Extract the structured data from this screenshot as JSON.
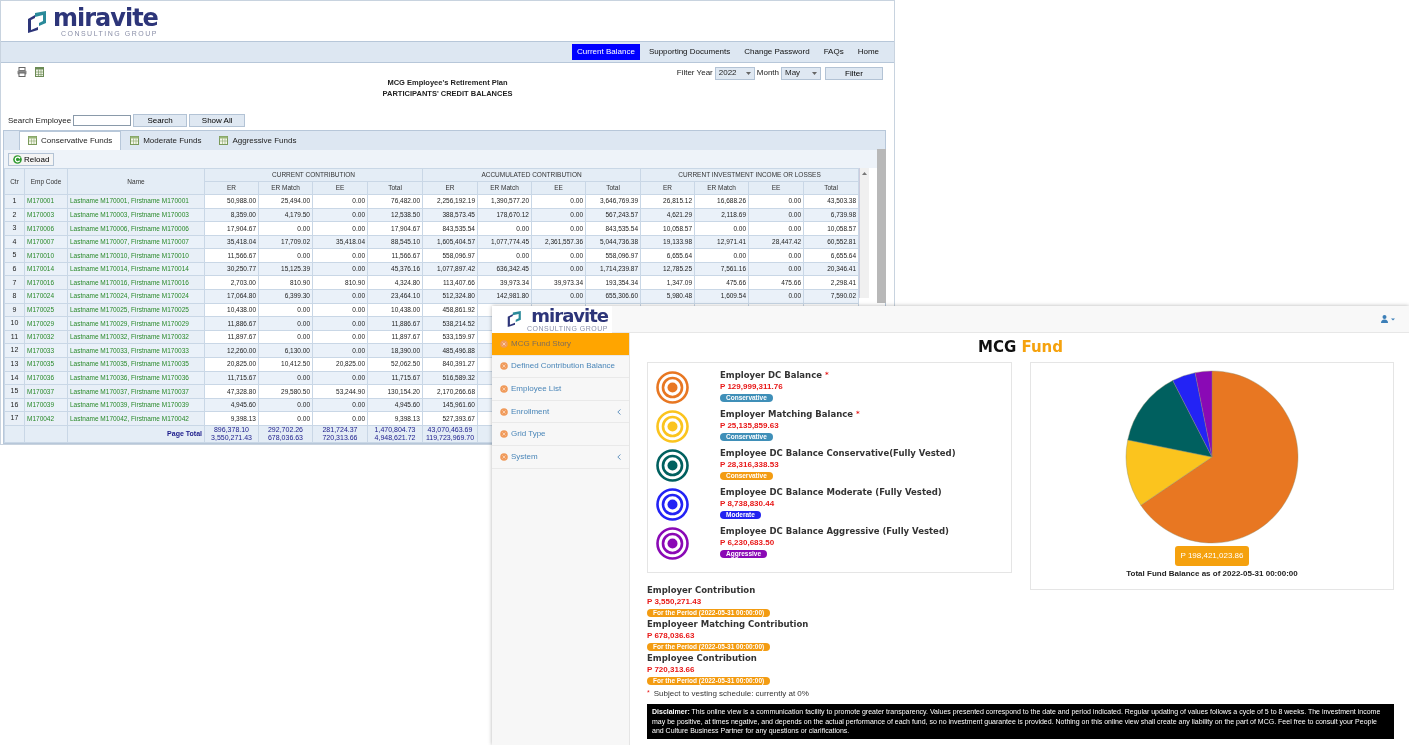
{
  "back_window": {
    "logo": {
      "name": "miravite",
      "tagline": "CONSULTING GROUP"
    },
    "nav": [
      {
        "label": "Current Balance",
        "selected": true
      },
      {
        "label": "Supporting Documents",
        "selected": false
      },
      {
        "label": "Change Password",
        "selected": false
      },
      {
        "label": "FAQs",
        "selected": false
      },
      {
        "label": "Home",
        "selected": false
      }
    ],
    "title": "MCG Employee's Retirement Plan",
    "subtitle": "PARTICIPANTS' CREDIT BALANCES",
    "filter": {
      "year_label": "Filter Year",
      "year": "2022",
      "month_label": "Month",
      "month": "May",
      "button": "Filter"
    },
    "search": {
      "label": "Search Employee",
      "button": "Search",
      "show_all": "Show All"
    },
    "tabs": [
      {
        "label": "Conservative Funds",
        "selected": true
      },
      {
        "label": "Moderate Funds",
        "selected": false
      },
      {
        "label": "Aggressive Funds",
        "selected": false
      }
    ],
    "reload": "Reload",
    "table": {
      "columns": [
        "Ctr",
        "Emp Code",
        "Name"
      ],
      "groups": [
        "CURRENT CONTRIBUTION",
        "ACCUMULATED CONTRIBUTION",
        "CURRENT INVESTMENT INCOME OR LOSSES"
      ],
      "sub_columns": [
        "ER",
        "ER Match",
        "EE",
        "Total",
        "ER",
        "ER Match",
        "EE",
        "Total",
        "ER",
        "ER Match",
        "EE",
        "Total"
      ],
      "rows": [
        {
          "ctr": "1",
          "code": "M170001",
          "name": "Lastname M170001, Firstname M170001",
          "values": [
            "50,988.00",
            "25,494.00",
            "0.00",
            "76,482.00",
            "2,256,192.19",
            "1,390,577.20",
            "0.00",
            "3,646,769.39",
            "26,815.12",
            "16,688.26",
            "0.00",
            "43,503.38"
          ]
        },
        {
          "ctr": "2",
          "code": "M170003",
          "name": "Lastname M170003, Firstname M170003",
          "values": [
            "8,359.00",
            "4,179.50",
            "0.00",
            "12,538.50",
            "388,573.45",
            "178,670.12",
            "0.00",
            "567,243.57",
            "4,621.29",
            "2,118.69",
            "0.00",
            "6,739.98"
          ]
        },
        {
          "ctr": "3",
          "code": "M170006",
          "name": "Lastname M170006, Firstname M170006",
          "values": [
            "17,904.67",
            "0.00",
            "0.00",
            "17,904.67",
            "843,535.54",
            "0.00",
            "0.00",
            "843,535.54",
            "10,058.57",
            "0.00",
            "0.00",
            "10,058.57"
          ]
        },
        {
          "ctr": "4",
          "code": "M170007",
          "name": "Lastname M170007, Firstname M170007",
          "values": [
            "35,418.04",
            "17,709.02",
            "35,418.04",
            "88,545.10",
            "1,605,404.57",
            "1,077,774.45",
            "2,361,557.36",
            "5,044,736.38",
            "19,133.98",
            "12,971.41",
            "28,447.42",
            "60,552.81"
          ]
        },
        {
          "ctr": "5",
          "code": "M170010",
          "name": "Lastname M170010, Firstname M170010",
          "values": [
            "11,566.67",
            "0.00",
            "0.00",
            "11,566.67",
            "558,096.97",
            "0.00",
            "0.00",
            "558,096.97",
            "6,655.64",
            "0.00",
            "0.00",
            "6,655.64"
          ]
        },
        {
          "ctr": "6",
          "code": "M170014",
          "name": "Lastname M170014, Firstname M170014",
          "values": [
            "30,250.77",
            "15,125.39",
            "0.00",
            "45,376.16",
            "1,077,897.42",
            "636,342.45",
            "0.00",
            "1,714,239.87",
            "12,785.25",
            "7,561.16",
            "0.00",
            "20,346.41"
          ]
        },
        {
          "ctr": "7",
          "code": "M170016",
          "name": "Lastname M170016, Firstname M170016",
          "values": [
            "2,703.00",
            "810.90",
            "810.90",
            "4,324.80",
            "113,407.66",
            "39,973.34",
            "39,973.34",
            "193,354.34",
            "1,347.09",
            "475.66",
            "475.66",
            "2,298.41"
          ]
        },
        {
          "ctr": "8",
          "code": "M170024",
          "name": "Lastname M170024, Firstname M170024",
          "values": [
            "17,064.80",
            "6,399.30",
            "0.00",
            "23,464.10",
            "512,324.80",
            "142,981.80",
            "0.00",
            "655,306.60",
            "5,980.48",
            "1,609.54",
            "0.00",
            "7,590.02"
          ]
        },
        {
          "ctr": "9",
          "code": "M170025",
          "name": "Lastname M170025, Firstname M170025",
          "values": [
            "10,438.00",
            "0.00",
            "0.00",
            "10,438.00",
            "458,861.92"
          ]
        },
        {
          "ctr": "10",
          "code": "M170029",
          "name": "Lastname M170029, Firstname M170029",
          "values": [
            "11,886.67",
            "0.00",
            "0.00",
            "11,886.67",
            "538,214.52"
          ]
        },
        {
          "ctr": "11",
          "code": "M170032",
          "name": "Lastname M170032, Firstname M170032",
          "values": [
            "11,897.67",
            "0.00",
            "0.00",
            "11,897.67",
            "533,159.97"
          ]
        },
        {
          "ctr": "12",
          "code": "M170033",
          "name": "Lastname M170033, Firstname M170033",
          "values": [
            "12,260.00",
            "6,130.00",
            "0.00",
            "18,390.00",
            "485,496.88"
          ]
        },
        {
          "ctr": "13",
          "code": "M170035",
          "name": "Lastname M170035, Firstname M170035",
          "values": [
            "20,825.00",
            "10,412.50",
            "20,825.00",
            "52,062.50",
            "840,391.27"
          ]
        },
        {
          "ctr": "14",
          "code": "M170036",
          "name": "Lastname M170036, Firstname M170036",
          "values": [
            "11,715.67",
            "0.00",
            "0.00",
            "11,715.67",
            "516,589.32"
          ]
        },
        {
          "ctr": "15",
          "code": "M170037",
          "name": "Lastname M170037, Firstname M170037",
          "values": [
            "47,328.80",
            "29,580.50",
            "53,244.90",
            "130,154.20",
            "2,170,266.68"
          ]
        },
        {
          "ctr": "16",
          "code": "M170039",
          "name": "Lastname M170039, Firstname M170039",
          "values": [
            "4,945.60",
            "0.00",
            "0.00",
            "4,945.60",
            "145,961.60"
          ]
        },
        {
          "ctr": "17",
          "code": "M170042",
          "name": "Lastname M170042, Firstname M170042",
          "values": [
            "9,398.13",
            "0.00",
            "0.00",
            "9,398.13",
            "527,393.67"
          ]
        }
      ],
      "total": {
        "label": "Page Total",
        "values": [
          [
            "896,378.10",
            "3,550,271.43"
          ],
          [
            "292,702.26",
            "678,036.63"
          ],
          [
            "281,724.37",
            "720,313.66"
          ],
          [
            "1,470,804.73",
            "4,948,621.72"
          ],
          [
            "43,070,463.69",
            "119,723,969.70"
          ]
        ]
      }
    }
  },
  "front_window": {
    "logo": {
      "name": "miravite",
      "tagline": "CONSULTING GROUP"
    },
    "sidebar": [
      {
        "label": "MCG Fund Story",
        "selected": true,
        "expandable": false
      },
      {
        "label": "Defined Contribution Balance",
        "selected": false,
        "expandable": false
      },
      {
        "label": "Employee List",
        "selected": false,
        "expandable": false
      },
      {
        "label": "Enrollment",
        "selected": false,
        "expandable": true
      },
      {
        "label": "Grid Type",
        "selected": false,
        "expandable": false
      },
      {
        "label": "System",
        "selected": false,
        "expandable": true
      }
    ],
    "heading": {
      "text": "MCG",
      "accent": "Fund"
    },
    "balances": [
      {
        "title": "Employer DC Balance",
        "required": true,
        "amount": "P 129,999,311.76",
        "tag": {
          "label": "Conservative",
          "color": "#3f8fb8"
        },
        "color": "#e87722"
      },
      {
        "title": "Employer Matching Balance",
        "required": true,
        "amount": "P 25,135,859.63",
        "tag": {
          "label": "Conservative",
          "color": "#3f8fb8"
        },
        "color": "#fbc41e"
      },
      {
        "title": "Employee DC Balance Conservative(Fully Vested)",
        "required": false,
        "amount": "P 28,316,338.53",
        "tag": {
          "label": "Conservative",
          "color": "#f39c12"
        },
        "color": "#00605f"
      },
      {
        "title": "Employee DC Balance Moderate (Fully Vested)",
        "required": false,
        "amount": "P 8,738,830.44",
        "tag": {
          "label": "Moderate",
          "color": "#2323f0"
        },
        "color": "#2323f5"
      },
      {
        "title": "Employee DC Balance Aggressive (Fully Vested)",
        "required": false,
        "amount": "P 6,230,683.50",
        "tag": {
          "label": "Aggressive",
          "color": "#8a09b5"
        },
        "color": "#8a09b5"
      }
    ],
    "chart_data": {
      "type": "pie",
      "values": [
        65.52,
        12.67,
        14.27,
        4.4,
        3.14
      ]
    },
    "total": {
      "amount": "P 198,421,023.86",
      "caption": "Total Fund Balance as of 2022-05-31 00:00:00"
    },
    "contributions": [
      {
        "title": "Employer Contribution",
        "amount": "P 3,550,271.43",
        "period": "For the Period (2022-05-31 00:00:00)"
      },
      {
        "title": "Employeer Matching Contribution",
        "amount": "P 678,036.63",
        "period": "For the Period (2022-05-31 00:00:00)"
      },
      {
        "title": "Employee Contribution",
        "amount": "P 720,313.66",
        "period": "For the Period (2022-05-31 00:00:00)"
      }
    ],
    "note": {
      "marker": "*",
      "text": "Subject to vesting schedule: currently at 0%"
    },
    "disclaimer": "**Disclaimer:** This online view is a communication facility to promote greater transparency. Values presented correspond to the date and period indicated. Regular updating of values follows a cycle of 5 to 8 weeks. The investment income may be positive, at times negative, and depends on the actual performance of each fund, so no investment guarantee is provided. Nothing on this online view shall create any liability on the part of MCG. Feel free to consult your People and Culture Business Partner for any questions or clarifications."
  }
}
